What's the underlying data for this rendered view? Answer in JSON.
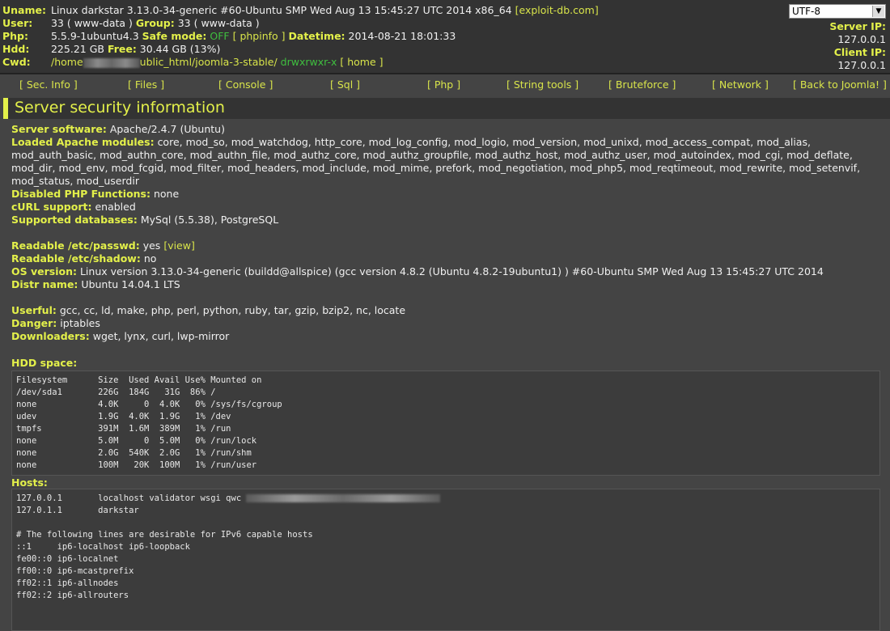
{
  "header": {
    "uname_label": "Uname:",
    "uname_value": "Linux darkstar 3.13.0-34-generic #60-Ubuntu SMP Wed Aug 13 15:45:27 UTC 2014 x86_64",
    "uname_link": "[exploit-db.com]",
    "user_label": "User:",
    "user_value": "33 ( www-data )",
    "group_label": "Group:",
    "group_value": "33 ( www-data )",
    "php_label": "Php:",
    "php_value": "5.5.9-1ubuntu4.3",
    "safe_mode_label": "Safe mode:",
    "safe_mode_value": "OFF",
    "phpinfo_link": "[ phpinfo ]",
    "datetime_label": "Datetime:",
    "datetime_value": "2014-08-21 18:01:33",
    "hdd_label": "Hdd:",
    "hdd_value": "225.21 GB",
    "free_label": "Free:",
    "free_value": "30.44 GB (13%)",
    "cwd_label": "Cwd:",
    "cwd_prefix": "/home",
    "cwd_suffix": "ublic_html/joomla-3-stable/",
    "cwd_perms": "drwxrwxr-x",
    "home_link": "[ home ]",
    "encoding": "UTF-8",
    "server_ip_label": "Server IP:",
    "server_ip": "127.0.0.1",
    "client_ip_label": "Client IP:",
    "client_ip": "127.0.0.1"
  },
  "menu": {
    "sec_info": "[ Sec. Info ]",
    "files": "[ Files ]",
    "console": "[ Console ]",
    "sql": "[ Sql ]",
    "php": "[ Php ]",
    "string_tools": "[ String tools ]",
    "bruteforce": "[ Bruteforce ]",
    "network": "[ Network ]",
    "back": "[ Back to Joomla! ]"
  },
  "main": {
    "title": "Server security information",
    "server_software_label": "Server software:",
    "server_software": "Apache/2.4.7 (Ubuntu)",
    "modules_label": "Loaded Apache modules:",
    "modules_line1": "core, mod_so, mod_watchdog, http_core, mod_log_config, mod_logio, mod_version, mod_unixd, mod_access_compat, mod_alias,",
    "modules_line2": "mod_auth_basic, mod_authn_core, mod_authn_file, mod_authz_core, mod_authz_groupfile, mod_authz_host, mod_authz_user, mod_autoindex, mod_cgi, mod_deflate,",
    "modules_line3": "mod_dir, mod_env, mod_fcgid, mod_filter, mod_headers, mod_include, mod_mime, prefork, mod_negotiation, mod_php5, mod_reqtimeout, mod_rewrite, mod_setenvif,",
    "modules_line4": "mod_status, mod_userdir",
    "disabled_label": "Disabled PHP Functions:",
    "disabled_value": "none",
    "curl_label": "cURL support:",
    "curl_value": "enabled",
    "db_label": "Supported databases:",
    "db_value": "MySql (5.5.38), PostgreSQL",
    "passwd_label": "Readable /etc/passwd:",
    "passwd_value": "yes",
    "passwd_link": "[view]",
    "shadow_label": "Readable /etc/shadow:",
    "shadow_value": "no",
    "os_label": "OS version:",
    "os_value": "Linux version 3.13.0-34-generic (buildd@allspice) (gcc version 4.8.2 (Ubuntu 4.8.2-19ubuntu1) ) #60-Ubuntu SMP Wed Aug 13 15:45:27 UTC 2014",
    "distr_label": "Distr name:",
    "distr_value": "Ubuntu 14.04.1 LTS",
    "userful_label": "Userful:",
    "userful_value": "gcc, cc, ld, make, php, perl, python, ruby, tar, gzip, bzip2, nc, locate",
    "danger_label": "Danger:",
    "danger_value": "iptables",
    "downloaders_label": "Downloaders:",
    "downloaders_value": "wget, lynx, curl, lwp-mirror",
    "hdd_space_label": "HDD space:",
    "hdd_space_text": "Filesystem      Size  Used Avail Use% Mounted on\n/dev/sda1       226G  184G   31G  86% /\nnone            4.0K     0  4.0K   0% /sys/fs/cgroup\nudev            1.9G  4.0K  1.9G   1% /dev\ntmpfs           391M  1.6M  389M   1% /run\nnone            5.0M     0  5.0M   0% /run/lock\nnone            2.0G  540K  2.0G   1% /run/shm\nnone            100M   20K  100M   1% /run/user",
    "hosts_label": "Hosts:",
    "hosts_line1": "127.0.0.1       localhost validator wsgi qwc ",
    "hosts_rest": "127.0.1.1       darkstar\n\n# The following lines are desirable for IPv6 capable hosts\n::1     ip6-localhost ip6-loopback\nfe00::0 ip6-localnet\nff00::0 ip6-mcastprefix\nff02::1 ip6-allnodes\nff02::2 ip6-allrouters"
  }
}
